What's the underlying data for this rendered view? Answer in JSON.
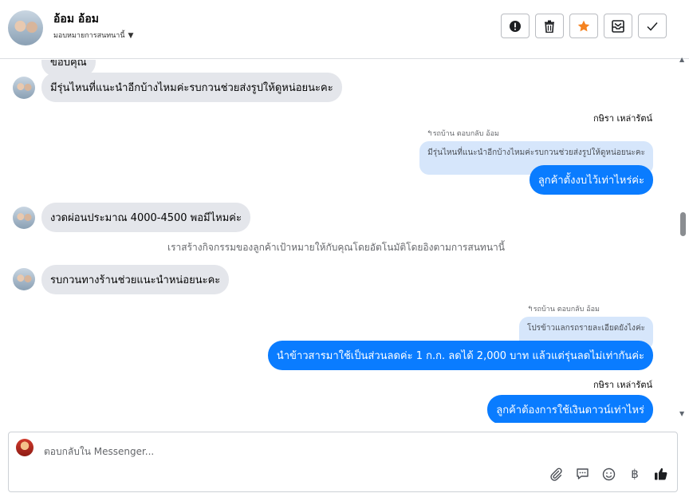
{
  "header": {
    "name": "อ้อม อ้อม",
    "subtitle": "มอบหมายการสนทนานี้"
  },
  "messages": {
    "m0_partial": "ขอบคุณ",
    "m1": "มีรุ่นไหนที่แนะนำอีกบ้างไหมค่ะรบกวนช่วยส่งรูปให้ดูหน่อยนะคะ",
    "sender1": "กษิรา เหล่ารัตน์",
    "reply_note1": "รถบ้าน ตอบกลับ อ้อม",
    "quote1": "มีรุ่นไหนที่แนะนำอีกบ้างไหมค่ะรบกวนช่วยส่งรูปให้ดูหน่อยนะคะ",
    "out1": "ลูกค้าตั้งงบไว้เท่าไหร่ค่ะ",
    "m2": "งวดผ่อนประมาณ 4000-4500 พอมีไหมค่ะ",
    "system": "เราสร้างกิจกรรมของลูกค้าเป้าหมายให้กับคุณโดยอัตโนมัติโดยอิงตามการสนทนานี้",
    "m3": "รบกวนทางร้านช่วยแนะนำหน่อยนะคะ",
    "reply_note2": "รถบ้าน ตอบกลับ อ้อม",
    "quote2": "โปรข้าวแลกรถรายละเอียดยังไงค่ะ",
    "out2": "นำข้าวสารมาใช้เป็นส่วนลดค่ะ 1 ก.ก. ลดได้ 2,000 บาท แล้วแต่รุ่นลดไม่เท่ากันค่ะ",
    "sender2": "กษิรา เหล่ารัตน์",
    "out3": "ลูกค้าต้องการใช้เงินดาวน์เท่าไหร่"
  },
  "composer": {
    "placeholder": "ตอบกลับใน Messenger..."
  },
  "icons": {
    "alert": "alert-icon",
    "trash": "trash-icon",
    "star": "star-icon",
    "archive": "archive-icon",
    "check": "check-icon",
    "attach": "paperclip-icon",
    "reply": "speech-icon",
    "emoji": "smiley-icon",
    "baht": "baht-icon",
    "like": "thumbs-up-icon"
  },
  "colors": {
    "accent": "#0a7cff",
    "star": "#f5821f",
    "incoming_bubble": "#e4e6eb",
    "quoted_bubble": "#d6e6fb"
  }
}
